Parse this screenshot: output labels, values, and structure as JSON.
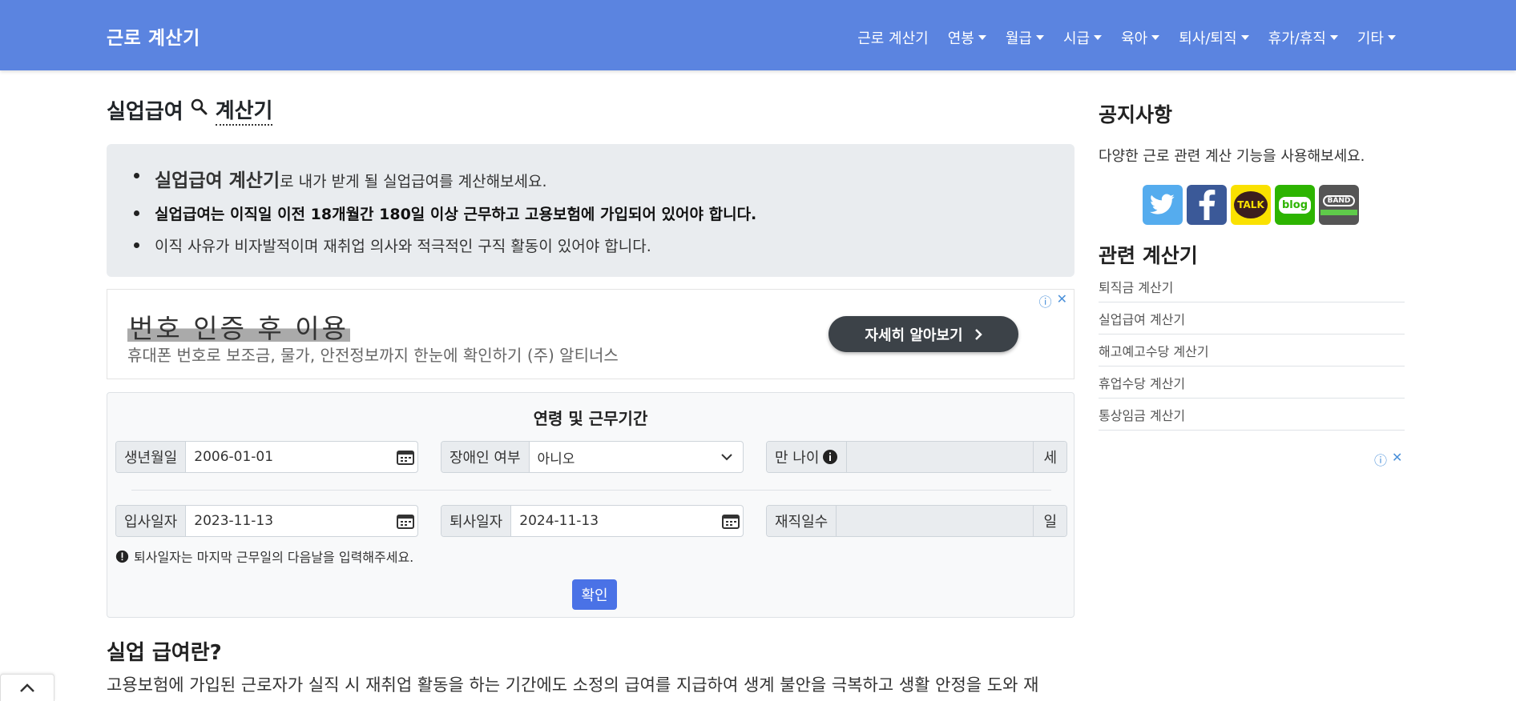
{
  "navbar": {
    "brand": "근로 계산기",
    "items": [
      {
        "label": "근로 계산기",
        "dropdown": false
      },
      {
        "label": "연봉",
        "dropdown": true
      },
      {
        "label": "월급",
        "dropdown": true
      },
      {
        "label": "시급",
        "dropdown": true
      },
      {
        "label": "육아",
        "dropdown": true
      },
      {
        "label": "퇴사/퇴직",
        "dropdown": true
      },
      {
        "label": "휴가/휴직",
        "dropdown": true
      },
      {
        "label": "기타",
        "dropdown": true
      }
    ]
  },
  "page": {
    "title_prefix": "실업급여",
    "title_suffix": "계산기"
  },
  "info": {
    "line1_bold": "실업급여 계산기",
    "line1_rest": "로 내가 받게 될 실업급여를 계산해보세요.",
    "line2": "실업급여는 이직일 이전 18개월간 180일 이상 근무하고 고용보험에 가입되어 있어야 합니다.",
    "line3": "이직 사유가 비자발적이며 재취업 의사와 적극적인 구직 활동이 있어야 합니다."
  },
  "ad": {
    "title": "번호 인증 후 이용",
    "subtitle": "휴대폰 번호로 보조금, 물가, 안전정보까지 한눈에 확인하기 (주) 알티너스",
    "button": "자세히 알아보기"
  },
  "form": {
    "heading": "연령 및 근무기간",
    "birth": {
      "label": "생년월일",
      "value": "2006-01-01"
    },
    "disability": {
      "label": "장애인 여부",
      "value": "아니오"
    },
    "age": {
      "label": "만 나이",
      "value": "",
      "unit": "세"
    },
    "start": {
      "label": "입사일자",
      "value": "2023-11-13"
    },
    "end": {
      "label": "퇴사일자",
      "value": "2024-11-13"
    },
    "days": {
      "label": "재직일수",
      "value": "",
      "unit": "일"
    },
    "note": "퇴사일자는 마지막 근무일의 다음날을 입력해주세요.",
    "confirm": "확인"
  },
  "section": {
    "title": "실업 급여란?",
    "text": "고용보험에 가입된 근로자가 실직 시 재취업 활동을 하는 기간에도 소정의 급여를 지급하여 생계 불안을 극복하고 생활 안정을 도와 재"
  },
  "sidebar": {
    "notice_title": "공지사항",
    "notice_desc": "다양한 근로 관련 계산 기능을 사용해보세요.",
    "social": [
      {
        "name": "twitter",
        "color": "#55acee"
      },
      {
        "name": "facebook",
        "color": "#3b5998"
      },
      {
        "name": "kakaotalk",
        "color": "#fae100",
        "text": "TALK"
      },
      {
        "name": "blog",
        "color": "#2db400",
        "text": "blog"
      },
      {
        "name": "band",
        "color": "#555555",
        "text": "BAND"
      }
    ],
    "related_title": "관련 계산기",
    "related": [
      "퇴직금 계산기",
      "실업급여 계산기",
      "해고예고수당 계산기",
      "휴업수당 계산기",
      "통상임금 계산기"
    ]
  }
}
